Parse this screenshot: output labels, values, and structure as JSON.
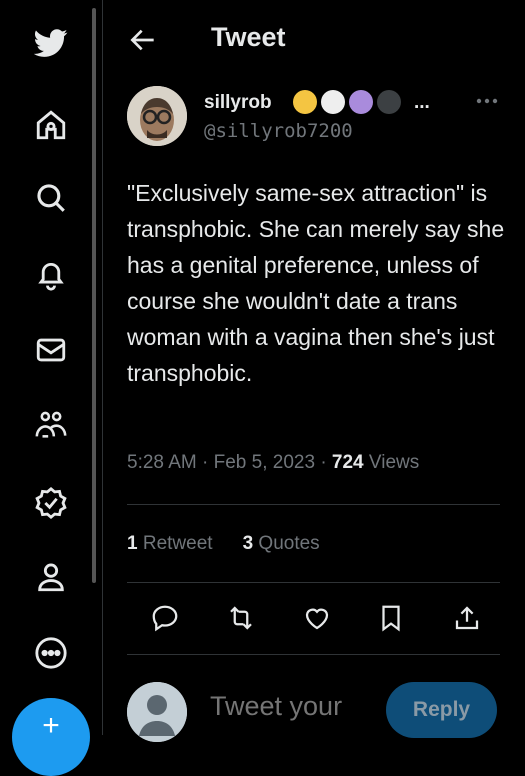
{
  "sidebar": {
    "items": [
      {
        "icon": "twitter-logo-icon"
      },
      {
        "icon": "home-icon"
      },
      {
        "icon": "search-icon"
      },
      {
        "icon": "bell-icon"
      },
      {
        "icon": "mail-icon"
      },
      {
        "icon": "communities-icon"
      },
      {
        "icon": "verified-icon"
      },
      {
        "icon": "profile-icon"
      },
      {
        "icon": "more-icon"
      }
    ],
    "compose_icon": "compose-icon"
  },
  "header": {
    "title": "Tweet"
  },
  "tweet": {
    "display_name": "sillyrob",
    "name_suffix": "...",
    "handle": "@sillyrob7200",
    "emoji_colors": [
      "#f4c542",
      "#eeeeee",
      "#a98bdc",
      "#3c4043"
    ],
    "text": "\"Exclusively same-sex attraction\" is transphobic. She can merely say she has a genital preference, unless of course she wouldn't date a trans woman with a vagina then she's just transphobic.",
    "time": "5:28 AM",
    "separator": "·",
    "date": "Feb 5, 2023",
    "views_count": "724",
    "views_label": "Views",
    "retweets_count": "1",
    "retweets_label": "Retweet",
    "quotes_count": "3",
    "quotes_label": "Quotes"
  },
  "reply": {
    "placeholder": "Tweet your",
    "button_label": "Reply"
  },
  "colors": {
    "background": "#000000",
    "text": "#e7e9ea",
    "muted": "#71767b",
    "accent": "#1d9bf0",
    "divider": "#2f3336"
  }
}
